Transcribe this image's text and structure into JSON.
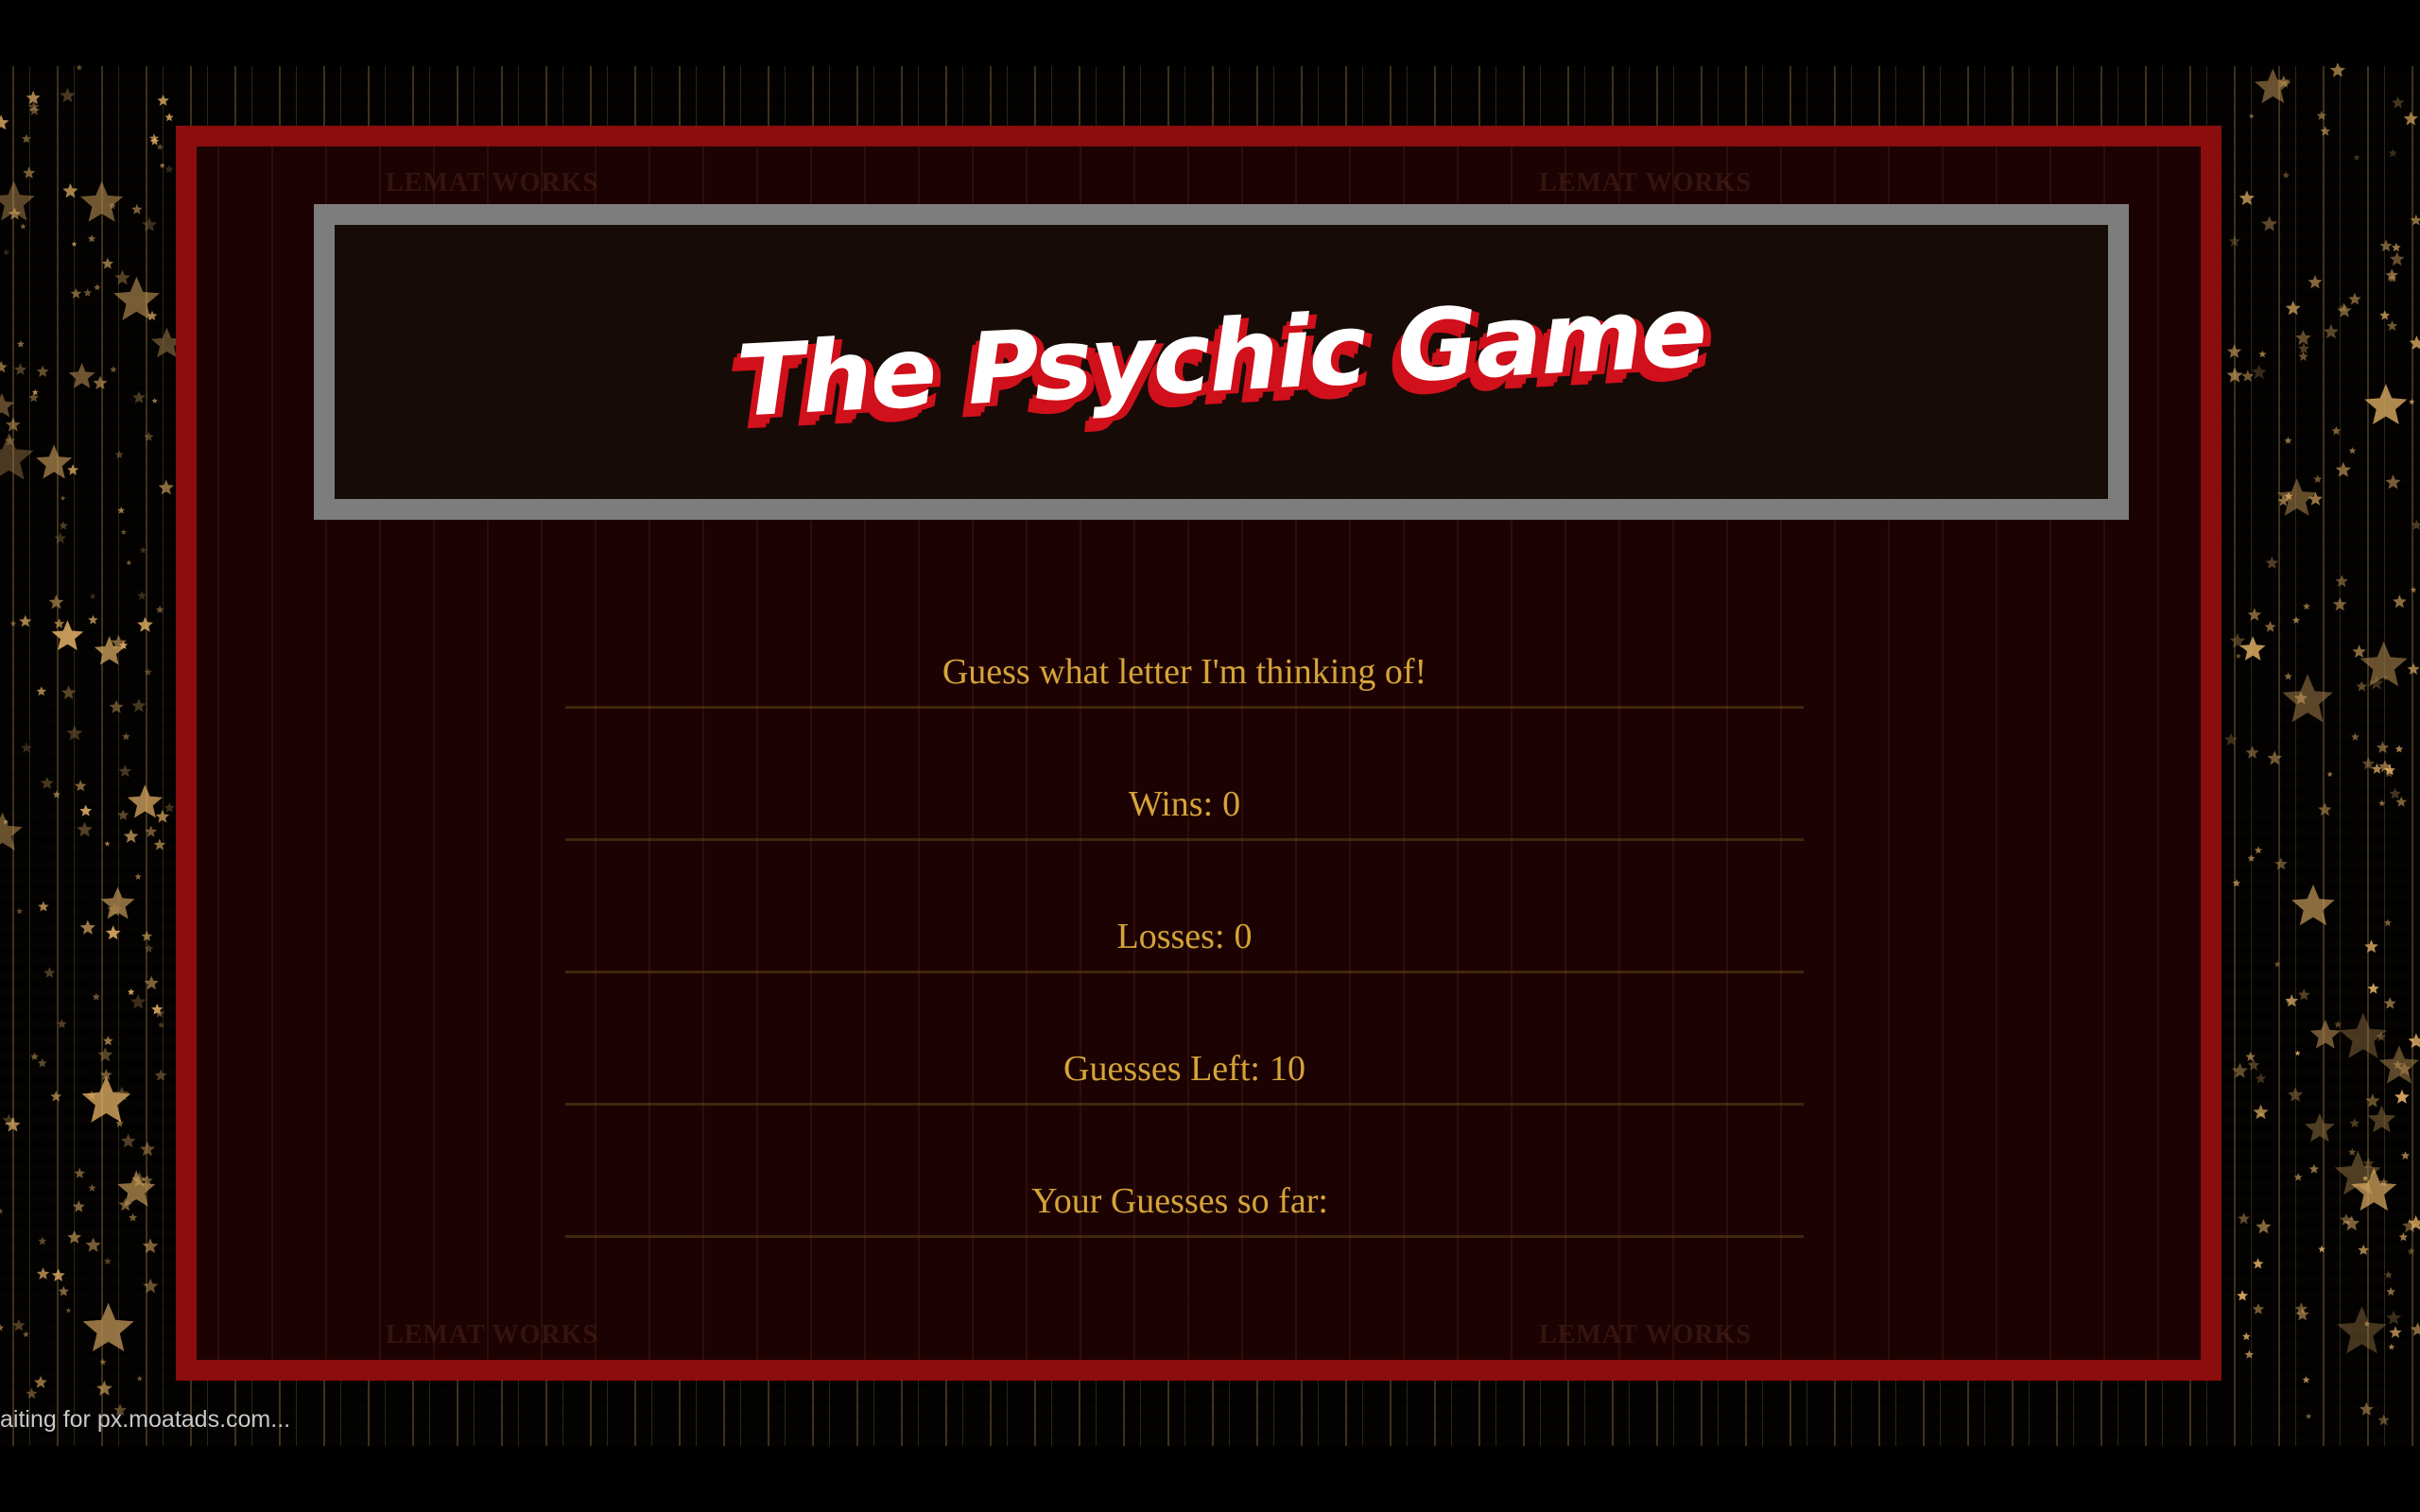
{
  "game": {
    "title": "The Psychic Game",
    "prompt": "Guess what letter I'm thinking of!",
    "wins_label": "Wins:",
    "wins_value": "0",
    "losses_label": "Losses:",
    "losses_value": "0",
    "guesses_left_label": "Guesses Left:",
    "guesses_left_value": "10",
    "guesses_so_far_label": "Your Guesses so far:",
    "guesses_so_far_value": ""
  },
  "watermarks": [
    "LEMAT WORKS",
    "LEMAT WORKS",
    "LEMAT WORKS",
    "LEMAT WORKS"
  ],
  "status_bar": {
    "text": "aiting for px.moatads.com..."
  },
  "colors": {
    "panel_border": "#8b0d0d",
    "title_border": "#7d7d7d",
    "title_shadow": "#d0101a",
    "text_gold": "#d4a439",
    "background": "#000000"
  }
}
